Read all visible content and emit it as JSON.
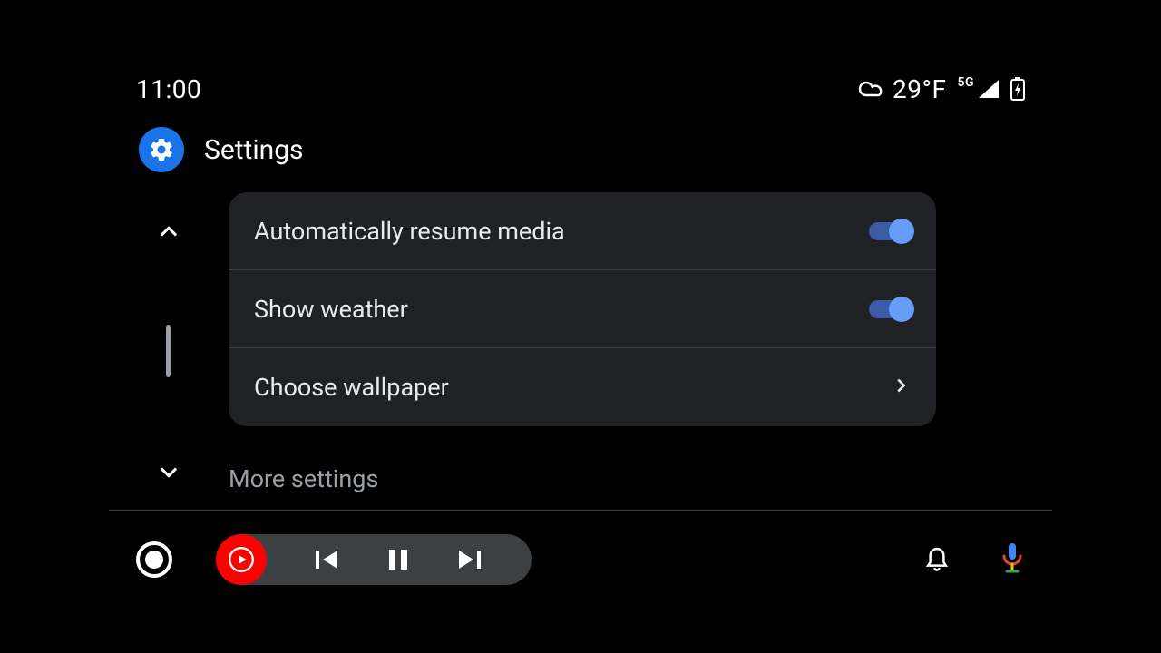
{
  "statusbar": {
    "time": "11:00",
    "temperature": "29°F",
    "network_label": "5G"
  },
  "header": {
    "title": "Settings"
  },
  "settings": {
    "rows": [
      {
        "label": "Automatically resume media",
        "type": "toggle",
        "on": true
      },
      {
        "label": "Show weather",
        "type": "toggle",
        "on": true
      },
      {
        "label": "Choose wallpaper",
        "type": "link"
      }
    ],
    "more_label": "More settings"
  }
}
